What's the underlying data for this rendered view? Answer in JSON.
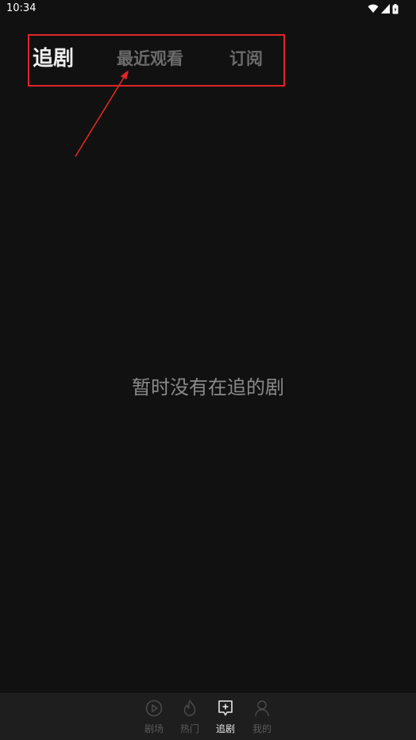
{
  "status_bar": {
    "time": "10:34",
    "icons": [
      "wifi-icon",
      "signal-icon",
      "battery-icon"
    ]
  },
  "tabs": [
    {
      "label": "追剧",
      "active": true
    },
    {
      "label": "最近观看",
      "active": false
    },
    {
      "label": "订阅",
      "active": false
    }
  ],
  "empty_state": {
    "message": "暂时没有在追的剧"
  },
  "bottom_nav": {
    "items": [
      {
        "label": "剧场",
        "icon": "play-circle-icon",
        "active": false
      },
      {
        "label": "热门",
        "icon": "flame-icon",
        "active": false
      },
      {
        "label": "追剧",
        "icon": "add-square-icon",
        "active": true
      },
      {
        "label": "我的",
        "icon": "person-icon",
        "active": false
      }
    ]
  },
  "colors": {
    "background": "#111112",
    "nav_background": "#1e1e1f",
    "active_text": "#eeeeee",
    "inactive_text": "#6b6b6b",
    "annotation": "#e02626"
  }
}
